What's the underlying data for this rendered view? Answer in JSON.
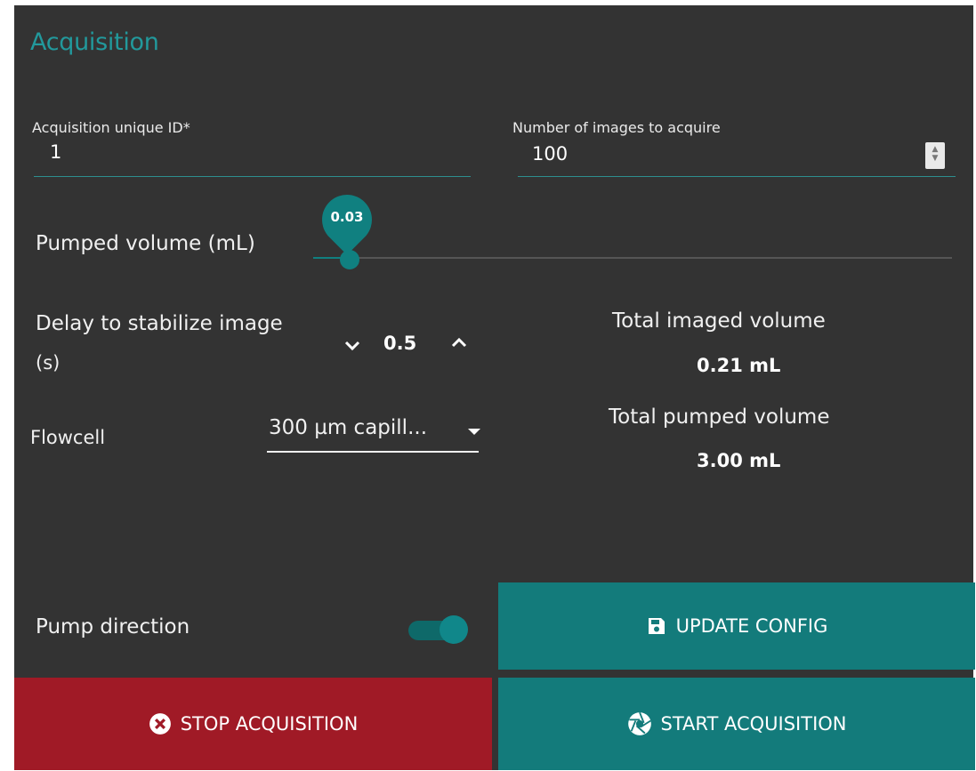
{
  "title": "Acquisition",
  "acquisition_id": {
    "label": "Acquisition unique ID*",
    "value": "1"
  },
  "num_images": {
    "label": "Number of images to acquire",
    "value": "100"
  },
  "pumped_volume": {
    "label": "Pumped volume (mL)",
    "value": "0.03",
    "level_fraction": 0.05
  },
  "delay": {
    "label_line1": "Delay to stabilize image",
    "label_line2": "(s)",
    "value": "0.5"
  },
  "flowcell": {
    "label": "Flowcell",
    "selected": "300 µm capill..."
  },
  "totals": {
    "imaged_label": "Total imaged volume",
    "imaged_value": "0.21 mL",
    "pumped_label": "Total pumped volume",
    "pumped_value": "3.00 mL"
  },
  "pump_direction": {
    "label": "Pump direction",
    "on": true
  },
  "buttons": {
    "update": "UPDATE CONFIG",
    "stop": "STOP ACQUISITION",
    "start": "START ACQUISITION"
  },
  "icons": {
    "update": "floppy-disk-icon",
    "stop": "close-circle-icon",
    "start": "camera-aperture-icon",
    "delay_down": "chevron-down-icon",
    "delay_up": "chevron-up-icon",
    "flowcell_dropdown": "caret-down-icon",
    "num_images_spinner": "spinner-icon"
  },
  "colors": {
    "accent": "#108080",
    "title": "#22999c",
    "danger": "#a01a26",
    "panel": "#333333"
  }
}
